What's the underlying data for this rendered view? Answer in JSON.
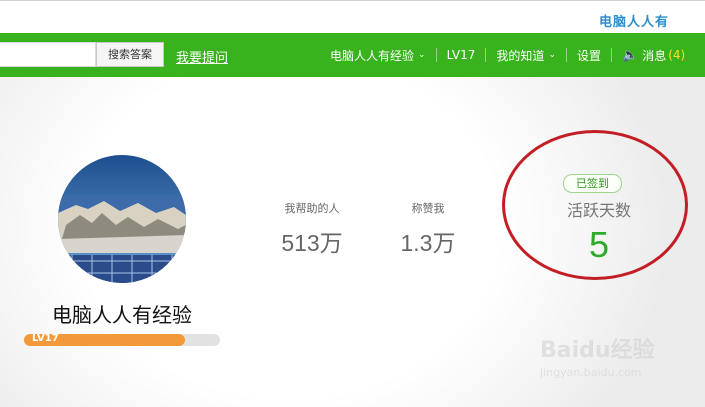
{
  "watermark_top": "电脑人人有",
  "search": {
    "button_label": "搜索答案",
    "value": ""
  },
  "ask_link": "我要提问",
  "nav": [
    {
      "label": "电脑人人有经验",
      "dropdown": true
    },
    {
      "label": "LV17",
      "dropdown": false
    },
    {
      "label": "我的知道",
      "dropdown": true
    },
    {
      "label": "设置",
      "dropdown": false
    }
  ],
  "messages": {
    "label": "消息",
    "count": "(4)",
    "icon": "speaker-icon"
  },
  "profile": {
    "username": "电脑人人有经验",
    "level_label": "LV17",
    "level_progress": 0.82,
    "avatar_caption": "电脑人人有"
  },
  "stats": [
    {
      "label": "我帮助的人",
      "value": "513万"
    },
    {
      "label": "称赞我",
      "value": "1.3万"
    }
  ],
  "checkin": {
    "badge": "已签到",
    "label": "活跃天数",
    "value": "5"
  },
  "watermark": {
    "brand": "Baidu经验",
    "url": "jingyan.baidu.com"
  },
  "colors": {
    "nav_green": "#38b21d",
    "level_orange": "#f29a3a",
    "active_green": "#2faa2a",
    "annotation_red": "#c31e26"
  }
}
